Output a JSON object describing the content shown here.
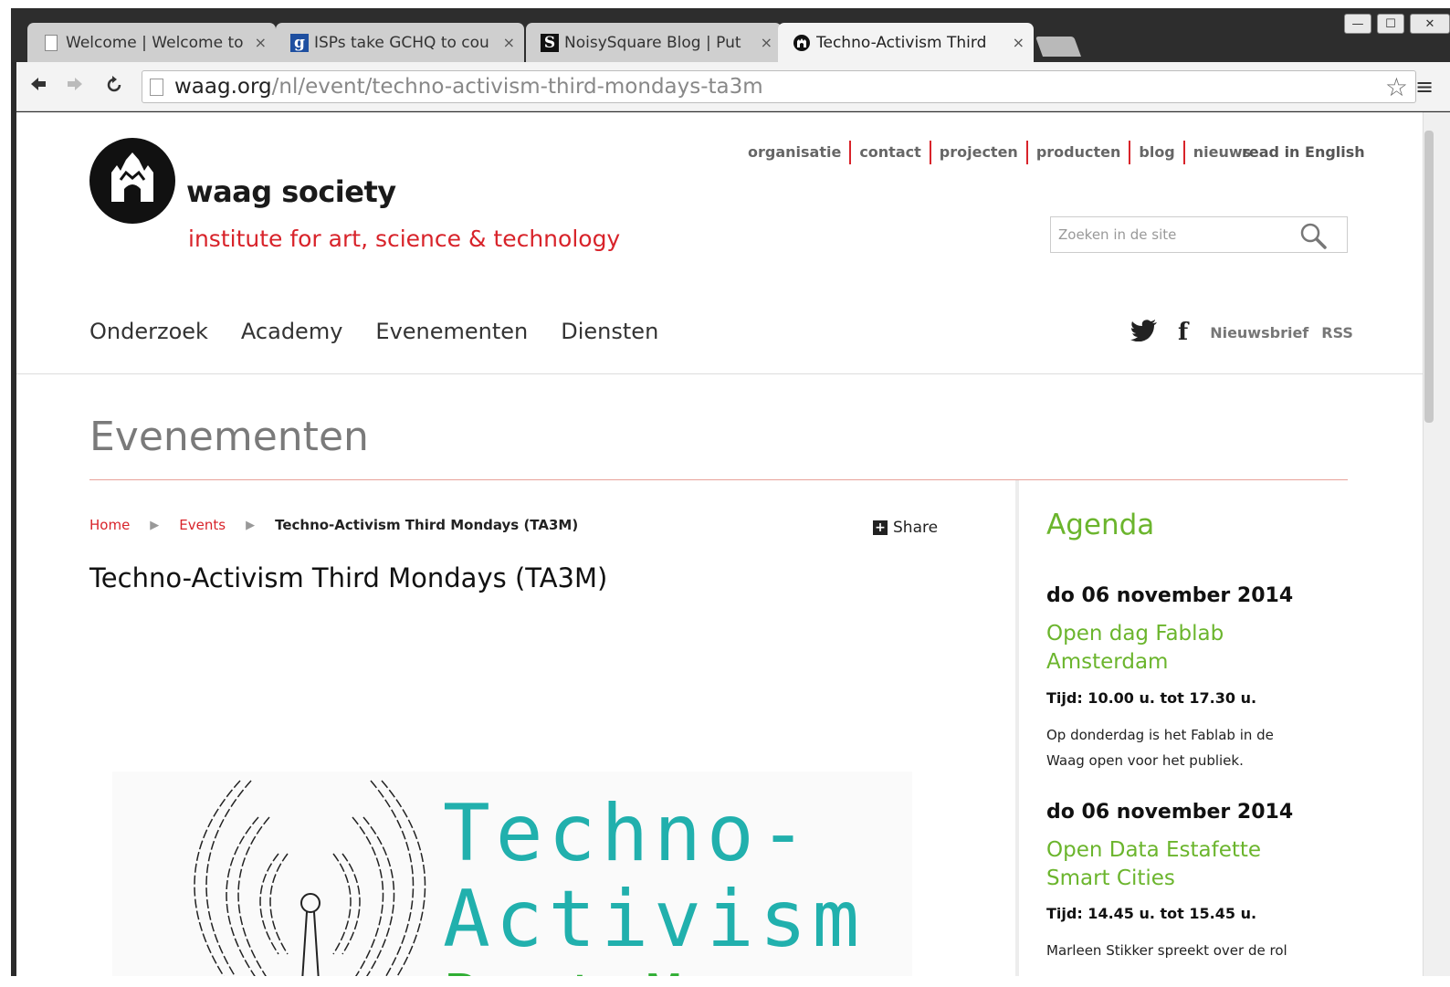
{
  "browser": {
    "tabs": [
      {
        "title": "Welcome | Welcome to",
        "favicon": "page-icon"
      },
      {
        "title": "ISPs take GCHQ to cou",
        "favicon": "g-icon"
      },
      {
        "title": "NoisySquare Blog | Put",
        "favicon": "s-icon"
      },
      {
        "title": "Techno-Activism Third",
        "favicon": "waag-icon"
      }
    ],
    "tab_favicon_g": "g",
    "tab_favicon_s": "S",
    "close_glyph": "×",
    "url_host": "waag.org",
    "url_path": "/nl/event/techno-activism-third-mondays-ta3m"
  },
  "site": {
    "logo_name": "waag society",
    "tagline": "institute for art, science & technology",
    "top_links": [
      "organisatie",
      "contact",
      "projecten",
      "producten",
      "blog",
      "nieuws"
    ],
    "read_english": "read in English",
    "search_placeholder": "Zoeken in de site",
    "main_nav": [
      "Onderzoek",
      "Academy",
      "Evenementen",
      "Diensten"
    ],
    "social": {
      "newsletter": "Nieuwsbrief",
      "rss": "RSS",
      "facebook_glyph": "f"
    },
    "brand_red": "#d8232a",
    "agenda_green": "#6bb52d"
  },
  "content": {
    "section_title": "Evenementen",
    "breadcrumb": {
      "home": "Home",
      "events": "Events",
      "current": "Techno-Activism Third Mondays (TA3M)",
      "separator": "▶"
    },
    "share_label": "Share",
    "share_glyph": "+",
    "event_title": "Techno-Activism Third Mondays (TA3M)",
    "image_text": {
      "line1": "Techno-",
      "line2": "Activism",
      "line3": "Past Mon"
    }
  },
  "agenda": {
    "title": "Agenda",
    "items": [
      {
        "date": "do 06 november 2014",
        "event": "Open dag Fablab Amsterdam",
        "time": "Tijd: 10.00 u. tot 17.30 u.",
        "desc": "Op donderdag is het Fablab in de Waag open voor het publiek."
      },
      {
        "date": "do 06 november 2014",
        "event": "Open Data Estafette Smart Cities",
        "time": "Tijd: 14.45 u. tot 15.45 u.",
        "desc": "Marleen Stikker spreekt over de rol"
      }
    ]
  }
}
